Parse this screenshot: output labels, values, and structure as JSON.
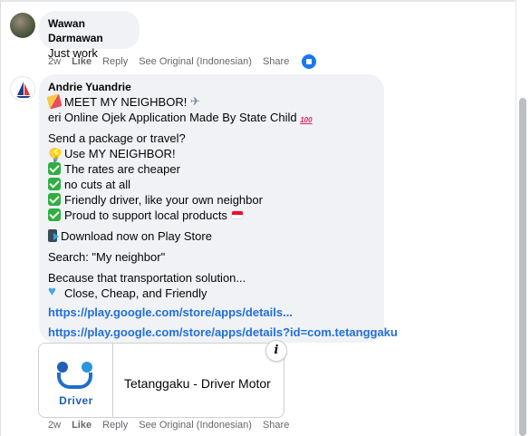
{
  "comments": [
    {
      "author": "Wawan Darmawan",
      "body": "Just work",
      "actions": {
        "time": "2w",
        "like": "Like",
        "reply": "Reply",
        "see_original": "See Original (Indonesian)",
        "share": "Share"
      },
      "reaction_icon": "like-thumb-icon"
    },
    {
      "author": "Andrie Yuandrie",
      "lines": [
        "MEET MY NEIGHBOR!",
        "eri Online Ojek Application Made By State Child",
        "Send a package or travel?",
        "Use MY NEIGHBOR!",
        "The rates are cheaper",
        "no cuts at all",
        "Friendly driver, like your own neighbor",
        "Proud to support local products",
        "Download now on Play Store",
        "Search: \"My neighbor\"",
        "Because that transportation solution...",
        "Close, Cheap, and Friendly"
      ],
      "links": [
        "https://play.google.com/store/apps/details...",
        "https://play.google.com/store/apps/details?id=com.tetanggaku"
      ],
      "link_preview": {
        "title": "Tetanggaku - Driver Motor",
        "thumb_label": "Driver",
        "info_symbol": "i"
      },
      "actions": {
        "time": "2w",
        "like": "Like",
        "reply": "Reply",
        "see_original": "See Original (Indonesian)",
        "share": "Share"
      }
    }
  ],
  "colors": {
    "link": "#216fdb",
    "bubble": "#f0f2f5",
    "meta": "#65676b",
    "like_blue": "#1877f2"
  }
}
